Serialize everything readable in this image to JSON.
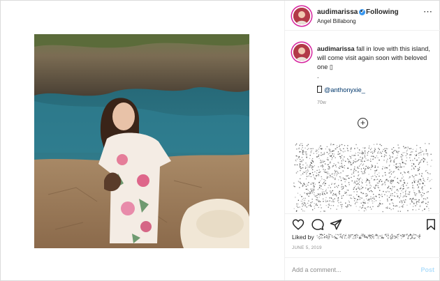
{
  "post": {
    "username": "audimarissa",
    "verified_mark": "✔",
    "separator": "•",
    "follow_status": "Following",
    "location": "Angel Billabong",
    "more_icon": "⋯"
  },
  "caption": {
    "username": "audimarissa",
    "text": "fall in love with this island, will come visit again soon with beloved one ▯\n.\n.",
    "mention": "@anthonyxie_",
    "age": "70w"
  },
  "load_more_icon": "+",
  "engagement": {
    "liked_by": "Liked by",
    "date": "JUNE 5, 2019"
  },
  "comment": {
    "placeholder": "Add a comment...",
    "post_label": "Post"
  },
  "icons": {
    "like": "heart-icon",
    "comment": "comment-icon",
    "share": "share-icon",
    "save": "bookmark-icon"
  },
  "colors": {
    "verified": "#3897f0",
    "link": "#00376b",
    "muted": "#8e8e8e",
    "post_disabled": "#b2dffc"
  }
}
